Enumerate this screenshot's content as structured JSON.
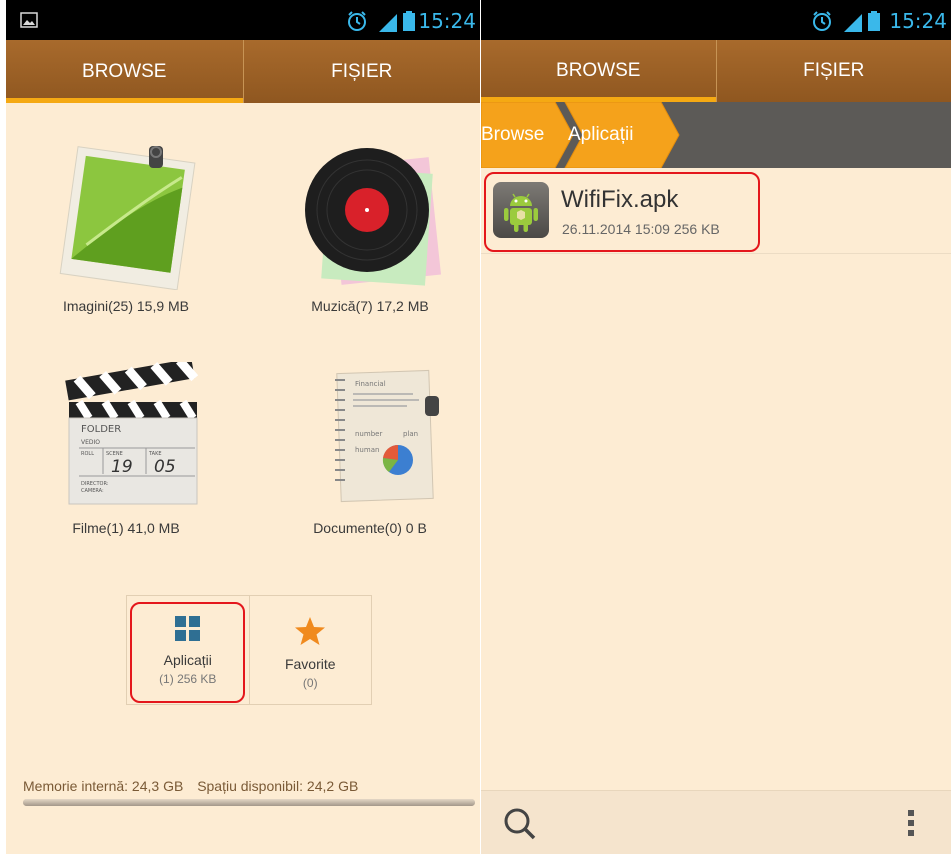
{
  "status": {
    "time": "15:24"
  },
  "tabs": {
    "browse": "BROWSE",
    "file": "FIȘIER"
  },
  "categories": [
    {
      "label": "Imagini(25) 15,9 MB"
    },
    {
      "label": "Muzică(7) 17,2 MB"
    },
    {
      "label": "Filme(1) 41,0 MB"
    },
    {
      "label": "Documente(0) 0 B"
    }
  ],
  "clapper": {
    "folder": "FOLDER",
    "vedio": "VEDIO",
    "roll": "ROLL",
    "scene": "SCENE",
    "take": "TAKE",
    "scene_no": "19",
    "take_no": "05",
    "director": "DIRECTOR:",
    "camera": "CAMERA:"
  },
  "notebook": {
    "title": "Financial",
    "word1": "number",
    "word2": "plan",
    "word3": "human"
  },
  "shortcuts": {
    "apps": {
      "label": "Aplicații",
      "sub": "(1) 256 KB"
    },
    "favorites": {
      "label": "Favorite",
      "sub": "(0)"
    }
  },
  "storage": {
    "internal": "Memorie internă: 24,3 GB",
    "free": "Spațiu disponibil: 24,2 GB",
    "used_fraction": 0.01
  },
  "breadcrumb": [
    "Browse",
    "Aplicații"
  ],
  "file": {
    "name": "WifiFix.apk",
    "meta": "26.11.2014 15:09  256 KB"
  },
  "colors": {
    "accent": "#f5a913",
    "tabbar": "#9b6125",
    "highlight": "#e4171c",
    "status_icons": "#3ab8ea"
  },
  "icons": {
    "search": "search-icon",
    "overflow": "overflow-menu-icon",
    "apps": "grid-icon",
    "favorites": "star-icon"
  }
}
